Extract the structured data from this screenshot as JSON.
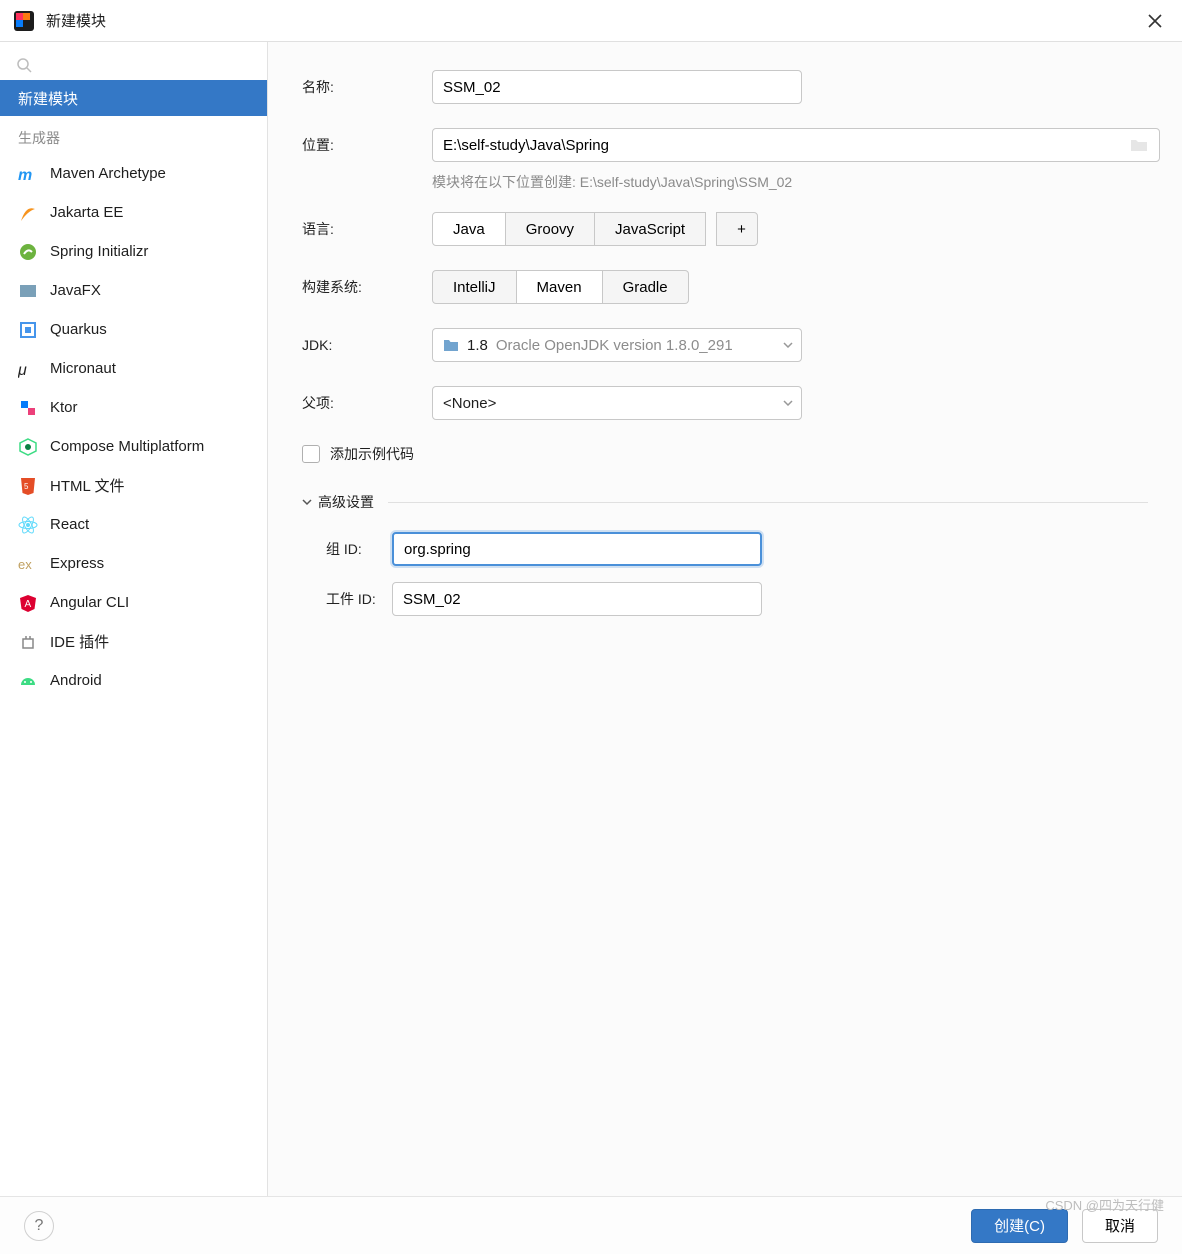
{
  "window": {
    "title": "新建模块"
  },
  "sidebar": {
    "selected_label": "新建模块",
    "section_label": "生成器",
    "items": [
      {
        "label": "Maven Archetype",
        "icon": "maven-icon",
        "color": "#2196F3"
      },
      {
        "label": "Jakarta EE",
        "icon": "jakarta-icon",
        "color": "#f7941e"
      },
      {
        "label": "Spring Initializr",
        "icon": "spring-icon",
        "color": "#6db33f"
      },
      {
        "label": "JavaFX",
        "icon": "javafx-icon",
        "color": "#7aa0b8"
      },
      {
        "label": "Quarkus",
        "icon": "quarkus-icon",
        "color": "#4695eb"
      },
      {
        "label": "Micronaut",
        "icon": "micronaut-icon",
        "color": "#222"
      },
      {
        "label": "Ktor",
        "icon": "ktor-icon",
        "color": "#ec407a"
      },
      {
        "label": "Compose Multiplatform",
        "icon": "compose-icon",
        "color": "#3ddc84"
      },
      {
        "label": "HTML 文件",
        "icon": "html-icon",
        "color": "#e44d26"
      },
      {
        "label": "React",
        "icon": "react-icon",
        "color": "#61dafb"
      },
      {
        "label": "Express",
        "icon": "express-icon",
        "color": "#c0a060"
      },
      {
        "label": "Angular CLI",
        "icon": "angular-icon",
        "color": "#dd0031"
      },
      {
        "label": "IDE 插件",
        "icon": "plugin-icon",
        "color": "#888"
      },
      {
        "label": "Android",
        "icon": "android-icon",
        "color": "#3ddc84"
      }
    ]
  },
  "form": {
    "name_label": "名称:",
    "name_value": "SSM_02",
    "location_label": "位置:",
    "location_value": "E:\\self-study\\Java\\Spring",
    "location_hint": "模块将在以下位置创建: E:\\self-study\\Java\\Spring\\SSM_02",
    "language_label": "语言:",
    "language_options": [
      "Java",
      "Groovy",
      "JavaScript"
    ],
    "language_selected": "Java",
    "build_label": "构建系统:",
    "build_options": [
      "IntelliJ",
      "Maven",
      "Gradle"
    ],
    "build_selected": "Maven",
    "jdk_label": "JDK:",
    "jdk_version": "1.8",
    "jdk_desc": "Oracle OpenJDK version 1.8.0_291",
    "parent_label": "父项:",
    "parent_value": "<None>",
    "sample_checkbox": "添加示例代码",
    "advanced_label": "高级设置",
    "group_id_label": "组 ID:",
    "group_id_value": "org.spring",
    "artifact_id_label": "工件 ID:",
    "artifact_id_value": "SSM_02"
  },
  "footer": {
    "create": "创建(C)",
    "cancel": "取消"
  },
  "watermark": "CSDN @四为天行健"
}
